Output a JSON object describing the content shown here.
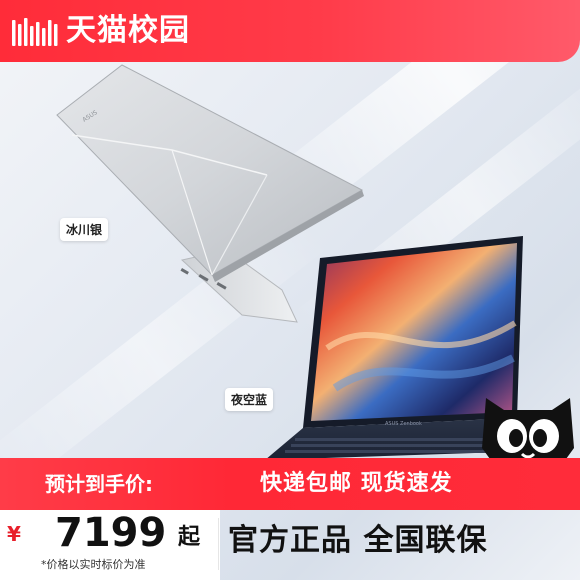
{
  "header": {
    "brand_name": "天猫校园",
    "brand_color": "#ff2c39"
  },
  "product": {
    "color_tags": [
      "冰川银",
      "夜空蓝"
    ]
  },
  "promo": {
    "price_label": "预计到手价:",
    "currency_symbol": "¥",
    "price": "7199",
    "price_suffix": "起",
    "price_note": "*价格以实时标价为准",
    "feature_line_1": "快递包邮  现货速发",
    "feature_line_2": "官方正品 全国联保"
  },
  "icons": {
    "brand_logo": "tmall-bars-icon",
    "mascot": "tmall-cat-mascot-icon"
  }
}
